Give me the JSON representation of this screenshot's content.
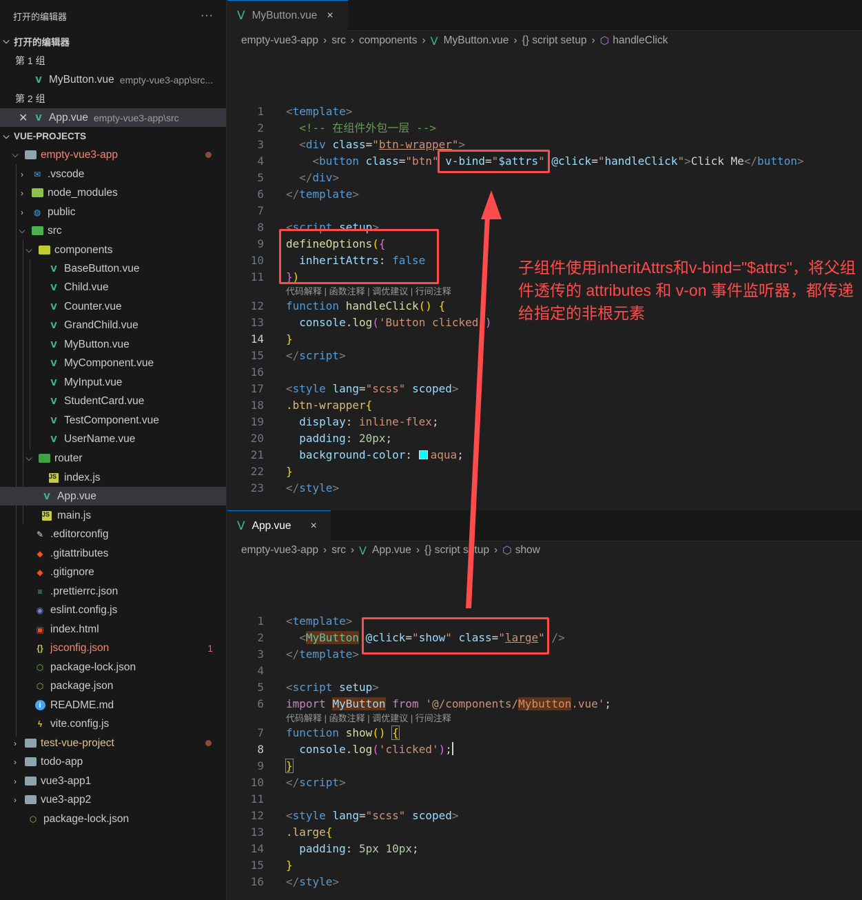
{
  "sidebar": {
    "title": "打开的编辑器",
    "more": "···",
    "open_editors_label": "打开的编辑器",
    "group1_label": "第 1 组",
    "group1_file": "MyButton.vue",
    "group1_desc": "empty-vue3-app\\src...",
    "group2_label": "第 2 组",
    "group2_file": "App.vue",
    "group2_desc": "empty-vue3-app\\src",
    "workspace_label": "VUE-PROJECTS",
    "tree": {
      "root": "empty-vue3-app",
      "vscode": ".vscode",
      "node_modules": "node_modules",
      "public": "public",
      "src": "src",
      "components": "components",
      "comp_files": [
        "BaseButton.vue",
        "Child.vue",
        "Counter.vue",
        "GrandChild.vue",
        "MyButton.vue",
        "MyComponent.vue",
        "MyInput.vue",
        "StudentCard.vue",
        "TestComponent.vue",
        "UserName.vue"
      ],
      "router": "router",
      "index_js": "index.js",
      "app_vue": "App.vue",
      "main_js": "main.js",
      "editorconfig": ".editorconfig",
      "gitattributes": ".gitattributes",
      "gitignore": ".gitignore",
      "prettierrc": ".prettierrc.json",
      "eslint": "eslint.config.js",
      "index_html": "index.html",
      "jsconfig": "jsconfig.json",
      "jsconfig_badge": "1",
      "package_lock": "package-lock.json",
      "package_json": "package.json",
      "readme": "README.md",
      "vite_config": "vite.config.js",
      "test_vue_project": "test-vue-project",
      "todo_app": "todo-app",
      "vue3_app1": "vue3-app1",
      "vue3_app2": "vue3-app2",
      "root_package_lock": "package-lock.json"
    }
  },
  "top_editor": {
    "tab": "MyButton.vue",
    "close": "×",
    "breadcrumb": [
      "empty-vue3-app",
      "src",
      "components",
      "MyButton.vue",
      "{} script setup",
      "handleClick"
    ],
    "codelens": "代码解释 | 函数注释 | 调优建议 | 行间注释",
    "line_numbers": [
      "1",
      "2",
      "3",
      "4",
      "5",
      "6",
      "7",
      "8",
      "9",
      "10",
      "11",
      "12",
      "13",
      "14",
      "15",
      "16",
      "17",
      "18",
      "19",
      "20",
      "21",
      "22",
      "23"
    ]
  },
  "bottom_editor": {
    "tab": "App.vue",
    "close": "×",
    "breadcrumb": [
      "empty-vue3-app",
      "src",
      "App.vue",
      "{} script setup",
      "show"
    ],
    "codelens": "代码解释 | 函数注释 | 调优建议 | 行间注释",
    "line_numbers": [
      "1",
      "2",
      "3",
      "4",
      "5",
      "6",
      "7",
      "8",
      "9",
      "10",
      "11",
      "12",
      "13",
      "14",
      "15",
      "16"
    ]
  },
  "annotation": "子组件使用inheritAttrs和v-bind=\"$attrs\"，将父组件透传的 attributes 和 v-on 事件监听器，都传递给指定的非根元素",
  "colors": {
    "annotation_red": "#ff4b4b",
    "vue_green": "#41b883",
    "swatch": "#00ffff"
  }
}
